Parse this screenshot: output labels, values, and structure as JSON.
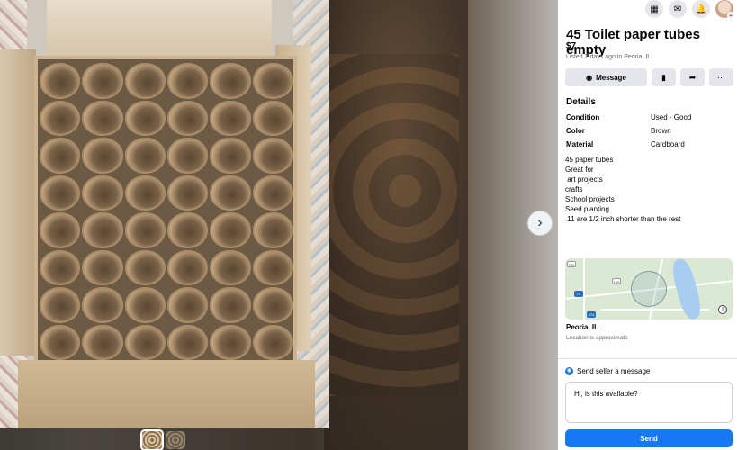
{
  "topbar": {
    "menu_icon": "grid-menu-icon",
    "messenger_icon": "messenger-icon",
    "notifications_icon": "bell-icon",
    "avatar_icon": "profile-avatar"
  },
  "listing": {
    "title": "45 Toilet paper tubes empty",
    "price": "$7",
    "listed_info": "Listed 2 days ago in Peoria, IL"
  },
  "actions": {
    "message_label": "Message",
    "save_icon": "bookmark-icon",
    "share_icon": "share-icon",
    "more_icon": "more-icon"
  },
  "details": {
    "heading": "Details",
    "rows": [
      {
        "key": "Condition",
        "value": "Used - Good"
      },
      {
        "key": "Color",
        "value": "Brown"
      },
      {
        "key": "Material",
        "value": "Cardboard"
      }
    ],
    "description": "45 paper tubes\nGreat for\n art projects\ncrafts\nSchool projects\nSeed planting\n 11 are 1/2 inch shorter than the rest"
  },
  "map": {
    "highway_labels": [
      "150",
      "150",
      "74",
      "474"
    ],
    "city": "Peoria, IL",
    "approx": "Location is approximate"
  },
  "send": {
    "heading": "Send seller a message",
    "message": "Hi, is this available?",
    "button": "Send"
  },
  "colors": {
    "accent": "#1877f2",
    "secondary_button": "#e4e6eb",
    "muted_text": "#65676b"
  },
  "viewer": {
    "next_icon": "chevron-right-icon"
  }
}
